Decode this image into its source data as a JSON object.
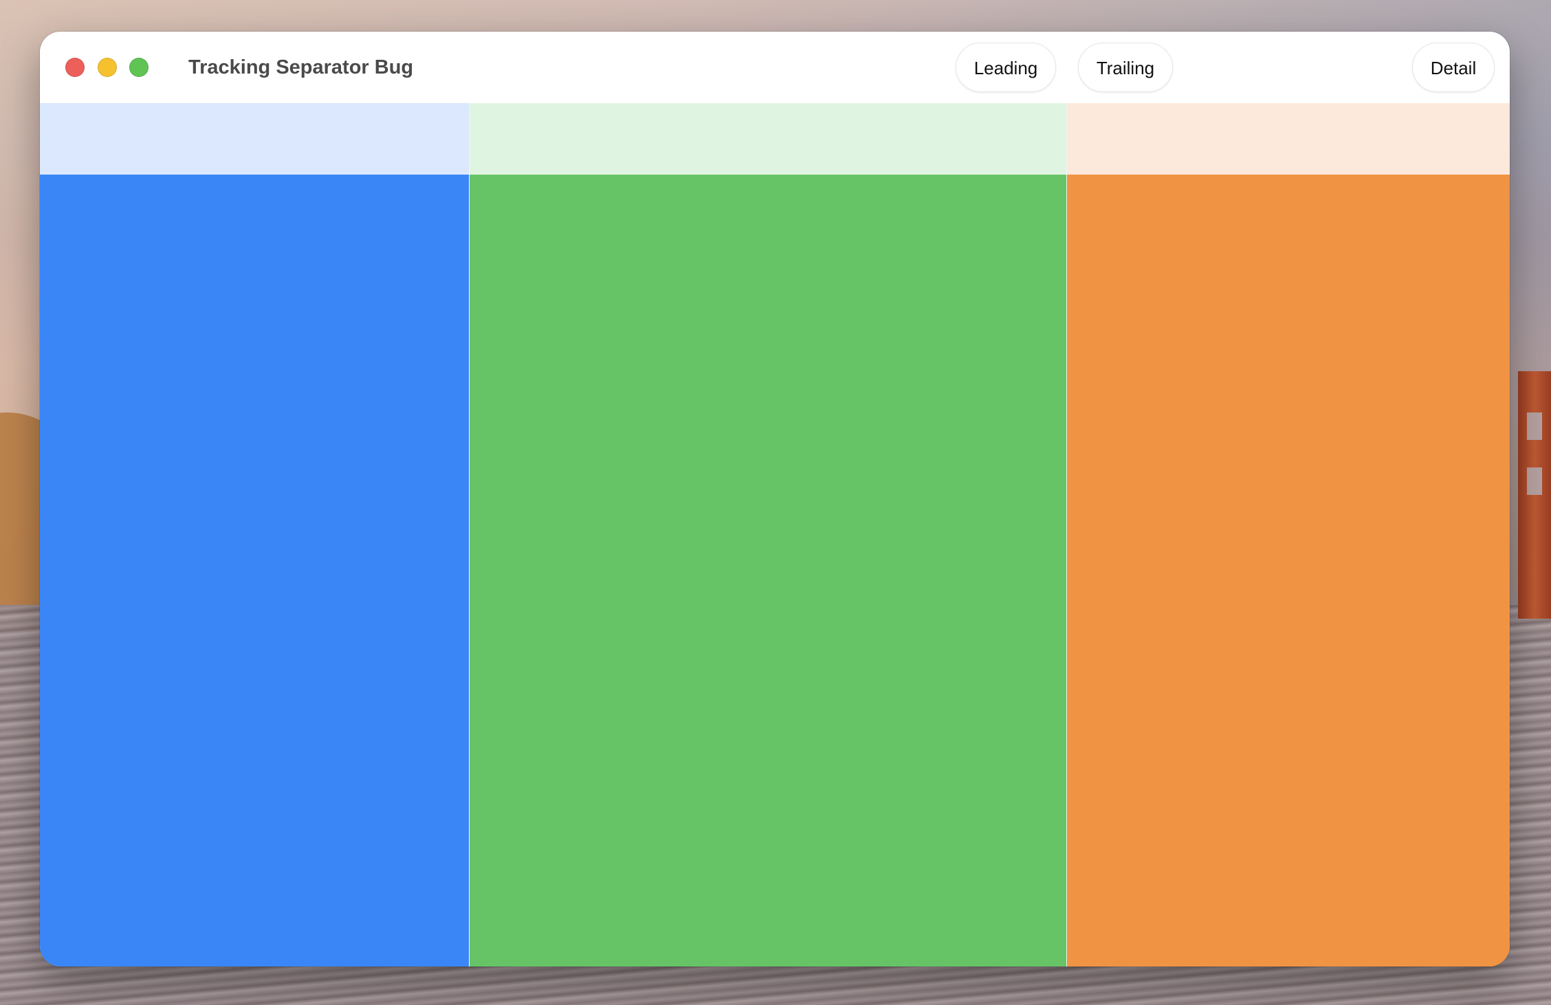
{
  "window": {
    "title": "Tracking Separator Bug"
  },
  "toolbar": {
    "leading_label": "Leading",
    "trailing_label": "Trailing",
    "detail_label": "Detail"
  },
  "columns": [
    {
      "name": "leading",
      "color": "#3b86f6",
      "header_tint": "#dbe8fd"
    },
    {
      "name": "center",
      "color": "#66c467",
      "header_tint": "#e0f5e1"
    },
    {
      "name": "trailing",
      "color": "#f09342",
      "header_tint": "#fde9dc"
    }
  ],
  "traffic_lights": {
    "close_color": "#ec5f5a",
    "minimize_color": "#f5c12f",
    "zoom_color": "#5fc454"
  }
}
